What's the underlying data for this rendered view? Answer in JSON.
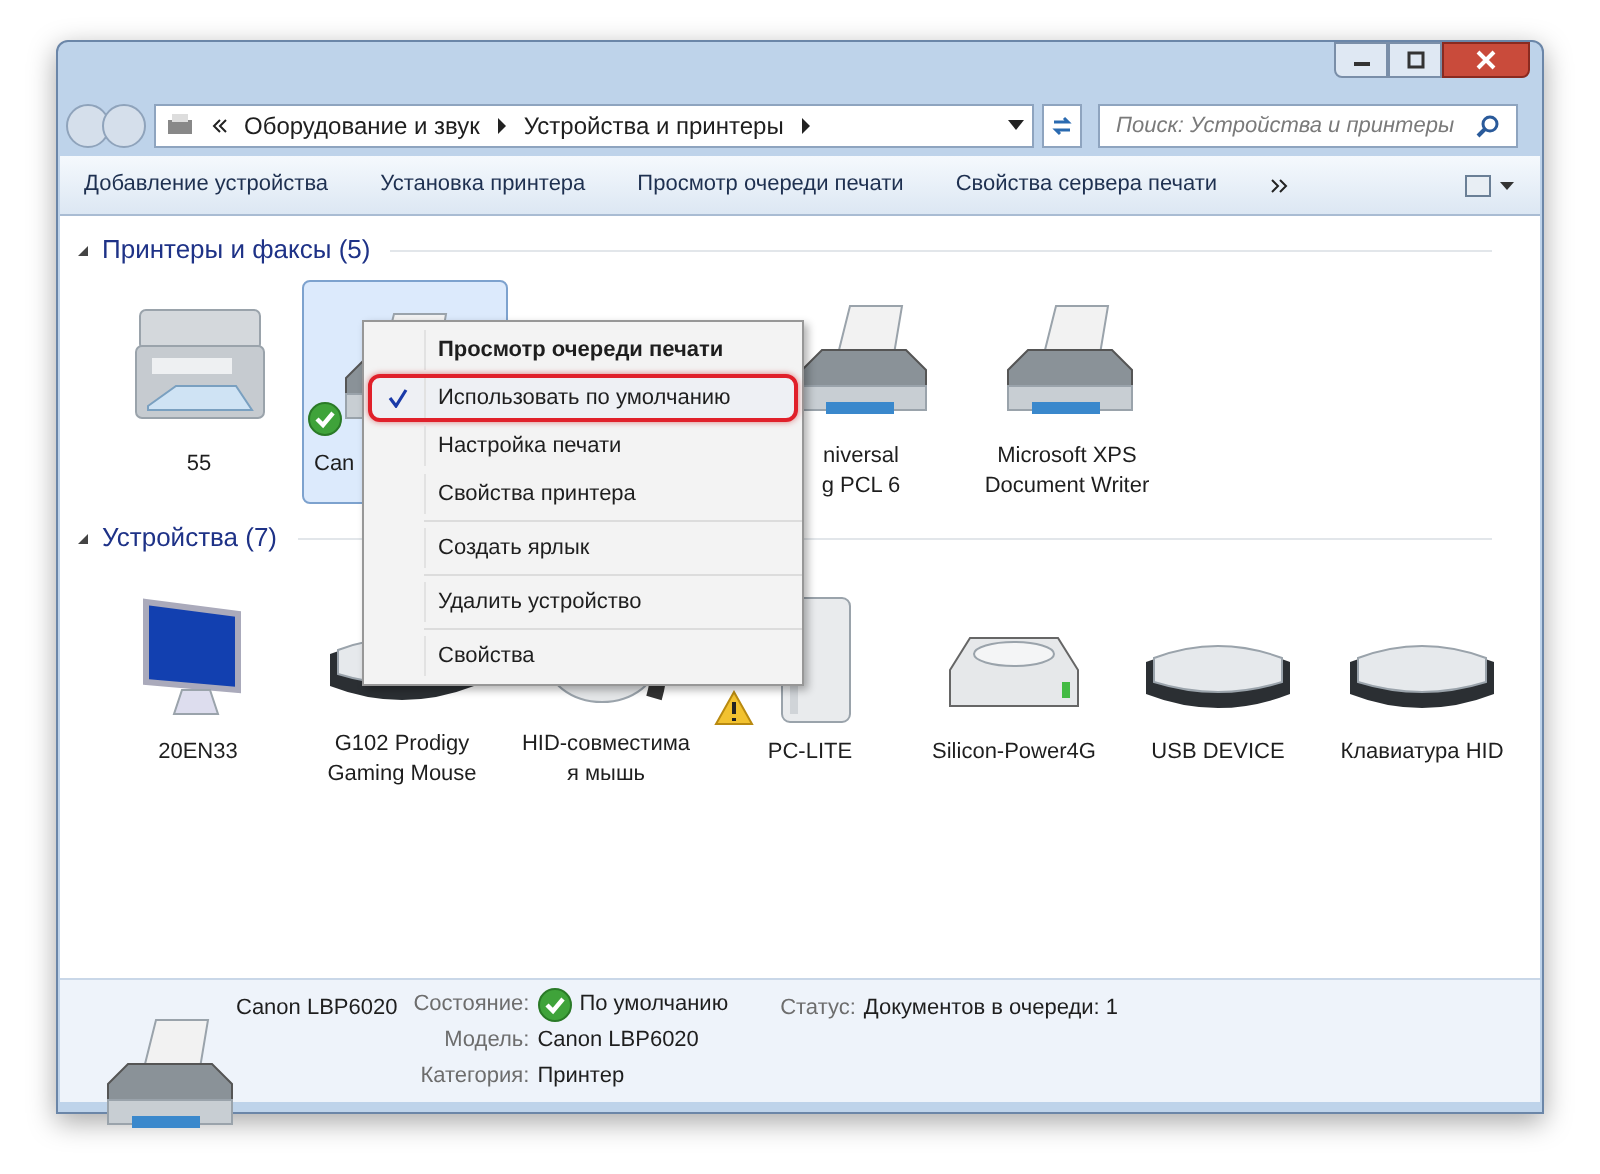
{
  "address": {
    "crumbs": [
      "Оборудование и звук",
      "Устройства и принтеры"
    ],
    "search_placeholder": "Поиск: Устройства и принтеры"
  },
  "toolbar": [
    "Добавление устройства",
    "Установка принтера",
    "Просмотр очереди печати",
    "Свойства сервера печати"
  ],
  "groups": [
    {
      "title": "Принтеры и факсы (5)",
      "items": [
        {
          "kind": "mfp",
          "label": "55",
          "selected": false
        },
        {
          "kind": "printer",
          "label": "Can",
          "selected": true,
          "is_default": true
        },
        {
          "kind": "hidden"
        },
        {
          "kind": "printer",
          "label": "niversal\ng PCL 6",
          "selected": false
        },
        {
          "kind": "printer",
          "label": "Microsoft XPS\nDocument Writer",
          "selected": false
        }
      ]
    },
    {
      "title": "Устройства (7)",
      "items": [
        {
          "kind": "monitor",
          "label": "20EN33",
          "selected": false
        },
        {
          "kind": "keyboard",
          "label": "G102 Prodigy\nGaming Mouse",
          "selected": false
        },
        {
          "kind": "mouse",
          "label": "HID-совместима\nя мышь",
          "selected": false
        },
        {
          "kind": "tower",
          "label": "PC-LITE",
          "selected": false,
          "has_warning": true
        },
        {
          "kind": "drive",
          "label": "Silicon-Power4G",
          "selected": false
        },
        {
          "kind": "keyboard",
          "label": "USB DEVICE",
          "selected": false
        },
        {
          "kind": "keyboard",
          "label": "Клавиатура HID",
          "selected": false
        }
      ]
    }
  ],
  "context_menu": [
    {
      "label": "Просмотр очереди печати",
      "bold": true,
      "checked": false,
      "highlighted": false
    },
    {
      "label": "Использовать по умолчанию",
      "checked": true,
      "highlighted": true
    },
    {
      "label": "Настройка печати",
      "checked": false,
      "highlighted": false
    },
    {
      "label": "Свойства принтера",
      "checked": false,
      "highlighted": false,
      "separator_after": true
    },
    {
      "label": "Создать ярлык",
      "checked": false,
      "highlighted": false,
      "separator_after": true
    },
    {
      "label": "Удалить устройство",
      "checked": false,
      "highlighted": false,
      "separator_after": true
    },
    {
      "label": "Свойства",
      "checked": false,
      "highlighted": false
    }
  ],
  "details": {
    "name": "Canon LBP6020",
    "fields": [
      {
        "label": "Состояние:",
        "value": "По умолчанию",
        "is_default": true
      },
      {
        "label": "Модель:",
        "value": "Canon LBP6020"
      },
      {
        "label": "Категория:",
        "value": "Принтер"
      }
    ],
    "status": {
      "label": "Статус:",
      "value": "Документов в очереди: 1"
    }
  }
}
